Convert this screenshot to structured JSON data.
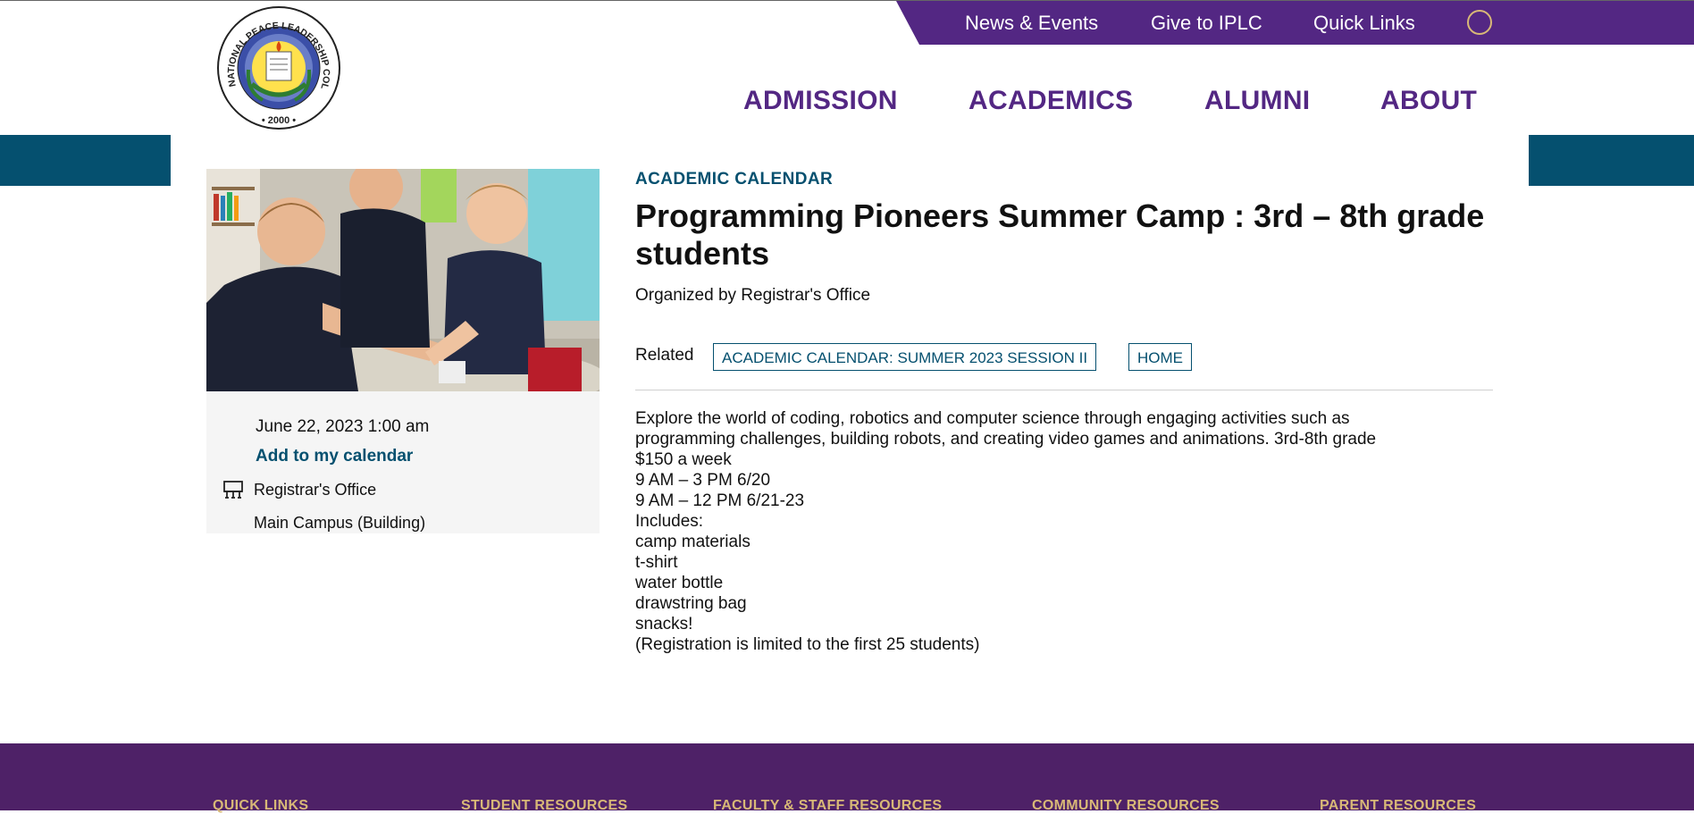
{
  "header": {
    "utility_links": [
      "News & Events",
      "Give to IPLC",
      "Quick Links"
    ],
    "logo": {
      "ring_text": "INTERNATIONAL PEACE LEADERSHIP COLLEGE",
      "year": "2000"
    },
    "nav": [
      "ADMISSION",
      "ACADEMICS",
      "ALUMNI",
      "ABOUT"
    ]
  },
  "sidebar": {
    "date": "June 22, 2023 1:00 am",
    "add_calendar": "Add to my calendar",
    "organizer": "Registrar's Office",
    "location": "Main Campus (Building)"
  },
  "event": {
    "eyebrow": "ACADEMIC CALENDAR",
    "title": "Programming Pioneers Summer Camp : 3rd – 8th grade students",
    "organized_by": "Organized by Registrar's Office",
    "related_label": "Related",
    "related_tags": [
      "ACADEMIC CALENDAR: SUMMER 2023 SESSION II",
      "HOME"
    ],
    "description": [
      "Explore the world of coding, robotics and computer science through engaging activities such as",
      "programming challenges, building robots, and creating video games and animations. 3rd-8th grade",
      "$150 a week",
      "9 AM – 3 PM 6/20",
      "9 AM – 12 PM 6/21-23",
      "Includes:",
      "camp materials",
      "t-shirt",
      "water bottle",
      "drawstring bag",
      "snacks!",
      "(Registration is limited to the first 25 students)"
    ]
  },
  "footer": {
    "headings": [
      "QUICK LINKS",
      "STUDENT RESOURCES",
      "FACULTY & STAFF RESOURCES",
      "COMMUNITY RESOURCES",
      "PARENT RESOURCES"
    ]
  },
  "colors": {
    "brand_purple": "#532783",
    "teal": "#05506f",
    "footer_purple": "#4e2167",
    "gold": "#d8b877"
  },
  "icons": [
    "search-icon",
    "building-icon"
  ]
}
